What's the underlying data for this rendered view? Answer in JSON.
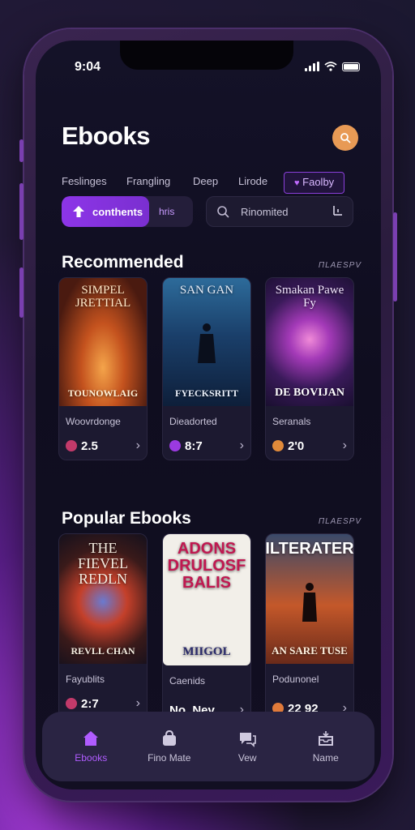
{
  "status_bar": {
    "time": "9:04"
  },
  "header": {
    "title": "Ebooks",
    "search_icon": "search-icon",
    "accent_color": "#e89a55"
  },
  "chips": [
    {
      "label": "Feslinges"
    },
    {
      "label": "Frangling"
    },
    {
      "label": "Deep"
    },
    {
      "label": "Lirode"
    },
    {
      "label": "Faolby",
      "icon": "heart-icon",
      "active": true
    }
  ],
  "toggle": {
    "active_label": "conthents",
    "inactive_label": "hris"
  },
  "search": {
    "placeholder": "Rinomited"
  },
  "recommended": {
    "title": "Recommended",
    "see_all": "ПLAESPV",
    "items": [
      {
        "cover_title": "SIMPEL JRETTIAL",
        "cover_bottom": "TOUNOWLAIG",
        "name": "Woovrdonge",
        "rating": "2.5",
        "dot_color": "#c23a6a"
      },
      {
        "cover_title": "SAN GAN",
        "cover_bottom": "FYECKSRITT",
        "name": "Dieadorted",
        "rating": "8:7",
        "dot_color": "#9b3ae0"
      },
      {
        "cover_title": "Smakan Pawe Fy",
        "cover_bottom": "DE BOVIJAN",
        "name": "Seranals",
        "rating": "2'0",
        "dot_color": "#e08a3a"
      }
    ]
  },
  "popular": {
    "title": "Popular Ebooks",
    "see_all": "ПLAESPV",
    "items": [
      {
        "cover_title": "THE FIEVEL REDLN",
        "cover_bottom": "REVLL CHAN",
        "name": "Fayublits",
        "rating": "2:7",
        "dot_color": "#c23a6a"
      },
      {
        "cover_title": "ADONS DRULOSF BALIS",
        "cover_bottom": "MIIGOL",
        "name": "Caenids",
        "rating": "No. Nev",
        "dot_color": ""
      },
      {
        "cover_title": "ILTERATER",
        "cover_bottom": "AN SARE TUSE",
        "name": "Podunonel",
        "rating": "22 92",
        "dot_color": "#e07a3a"
      }
    ]
  },
  "bottom_nav": [
    {
      "label": "Ebooks",
      "icon": "home-icon",
      "active": true
    },
    {
      "label": "Fino Mate",
      "icon": "bag-icon",
      "active": false
    },
    {
      "label": "Vew",
      "icon": "chat-icon",
      "active": false
    },
    {
      "label": "Name",
      "icon": "inbox-icon",
      "active": false
    }
  ]
}
